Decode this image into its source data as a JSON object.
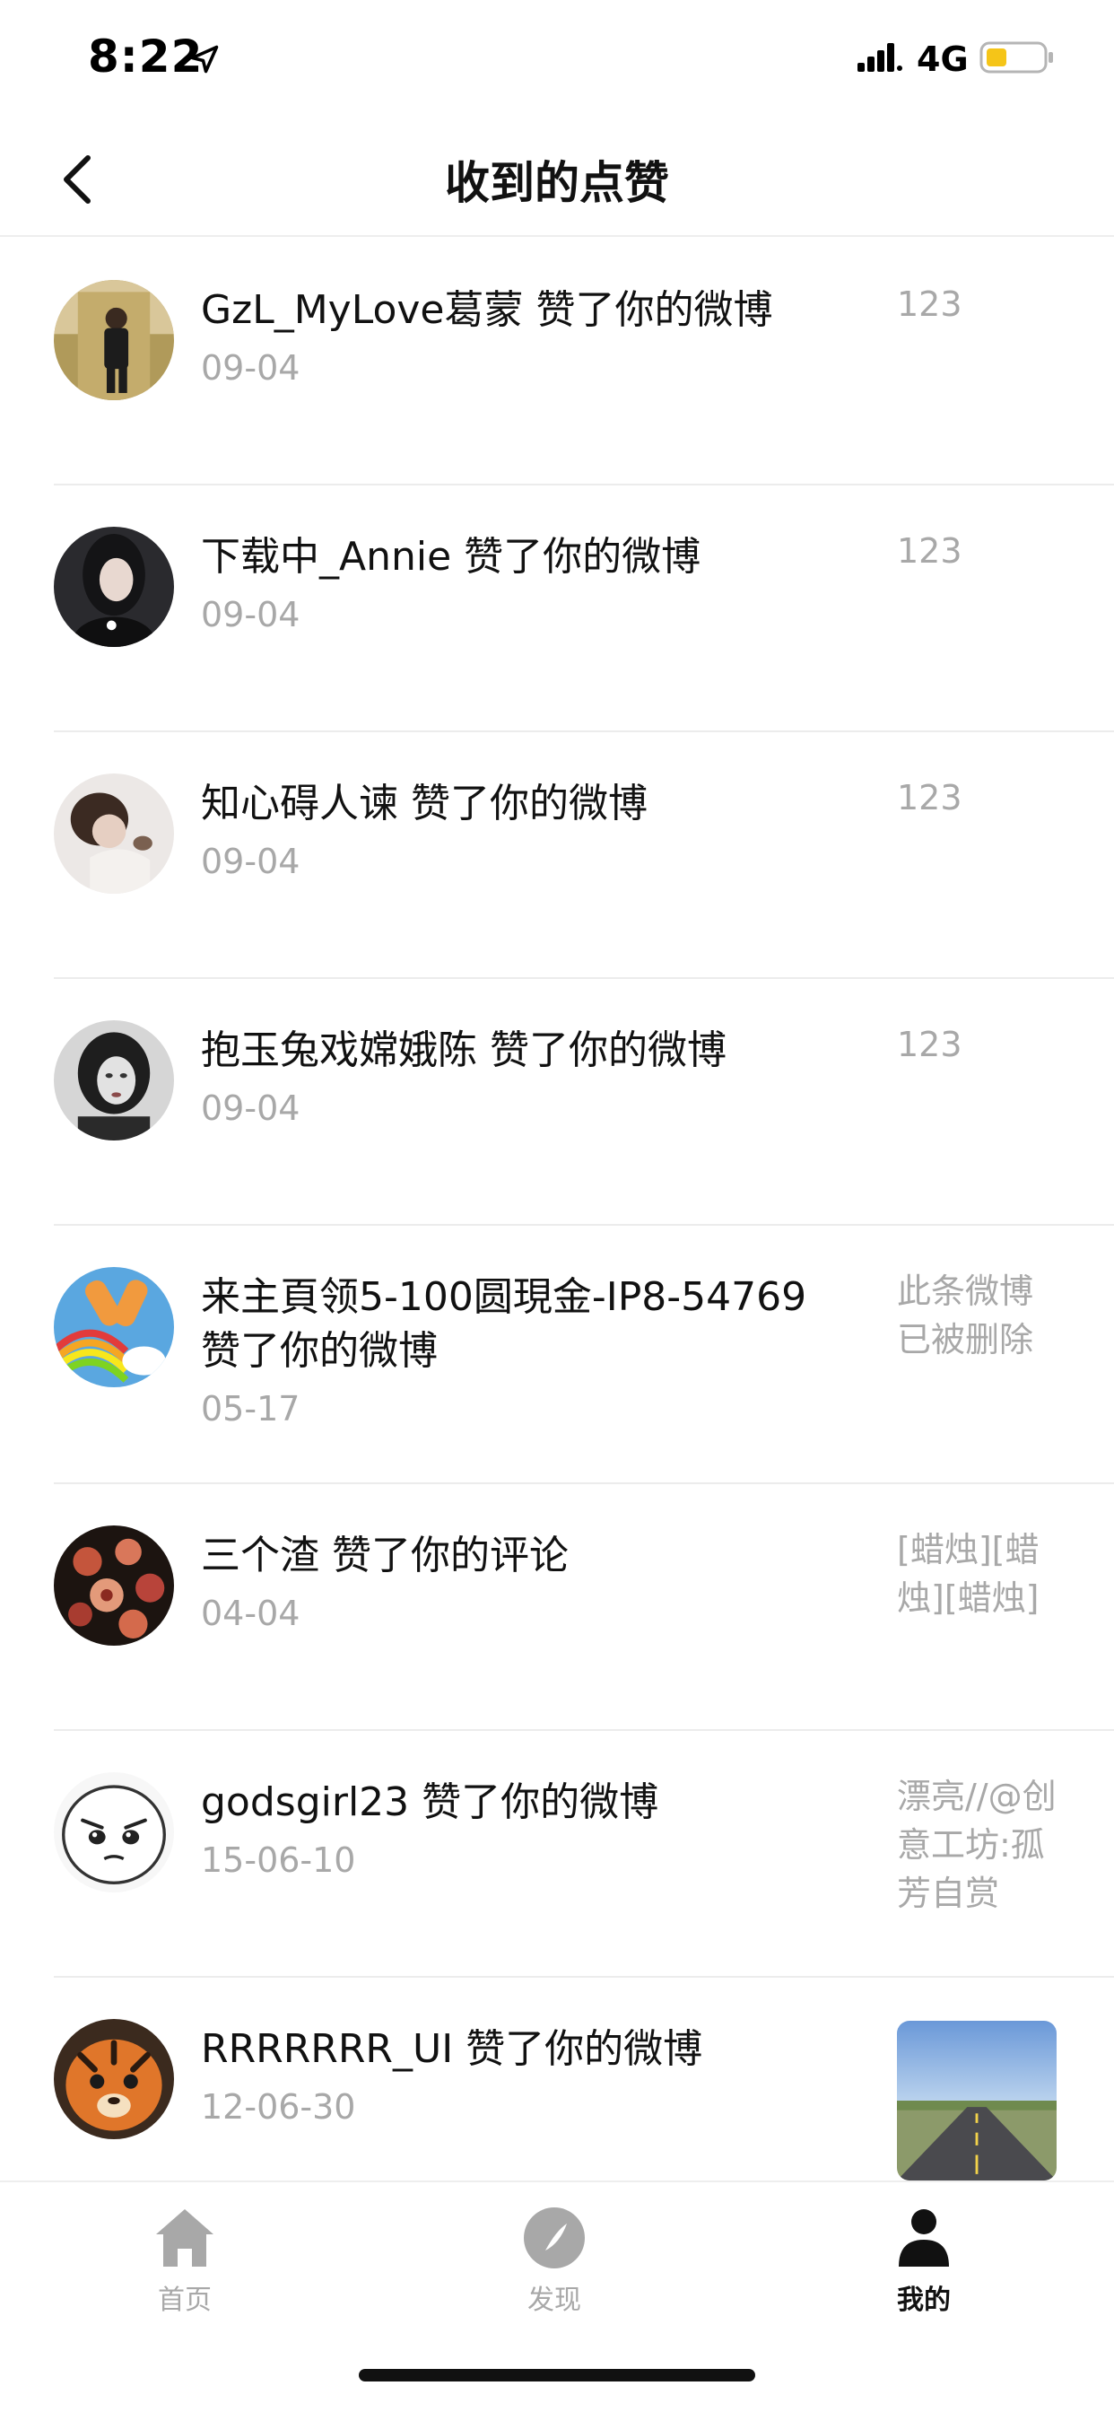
{
  "status_bar": {
    "time": "8:22",
    "network": "4G"
  },
  "nav": {
    "title": "收到的点赞"
  },
  "likes": [
    {
      "user": "GzL_MyLove葛蒙",
      "action": "赞了你的微博",
      "date": "09-04",
      "ref": "123"
    },
    {
      "user": "下载中_Annie",
      "action": "赞了你的微博",
      "date": "09-04",
      "ref": "123"
    },
    {
      "user": "知心碍人谏",
      "action": "赞了你的微博",
      "date": "09-04",
      "ref": "123"
    },
    {
      "user": "抱玉兔戏嫦娥陈",
      "action": "赞了你的微博",
      "date": "09-04",
      "ref": "123"
    },
    {
      "user": "来主頁领5-100圆現金-IP8-54769",
      "action": "赞了你的微博",
      "date": "05-17",
      "ref": "此条微博已被删除"
    },
    {
      "user": "三个渣",
      "action": "赞了你的评论",
      "date": "04-04",
      "ref": "[蜡烛][蜡烛][蜡烛]"
    },
    {
      "user": "godsgirl23",
      "action": "赞了你的微博",
      "date": "15-06-10",
      "ref": "漂亮//@创意工坊:孤芳自赏"
    },
    {
      "user": "RRRRRRR_UI",
      "action": "赞了你的微博",
      "date": "12-06-30",
      "ref_image": "road-photo"
    }
  ],
  "tabs": [
    {
      "label": "首页",
      "icon": "home-icon"
    },
    {
      "label": "发现",
      "icon": "compass-icon"
    },
    {
      "label": "我的",
      "icon": "profile-icon",
      "active": true
    }
  ],
  "colors": {
    "battery": "#f5c518",
    "muted_text": "#a8a8a8",
    "primary_text": "#111111"
  }
}
